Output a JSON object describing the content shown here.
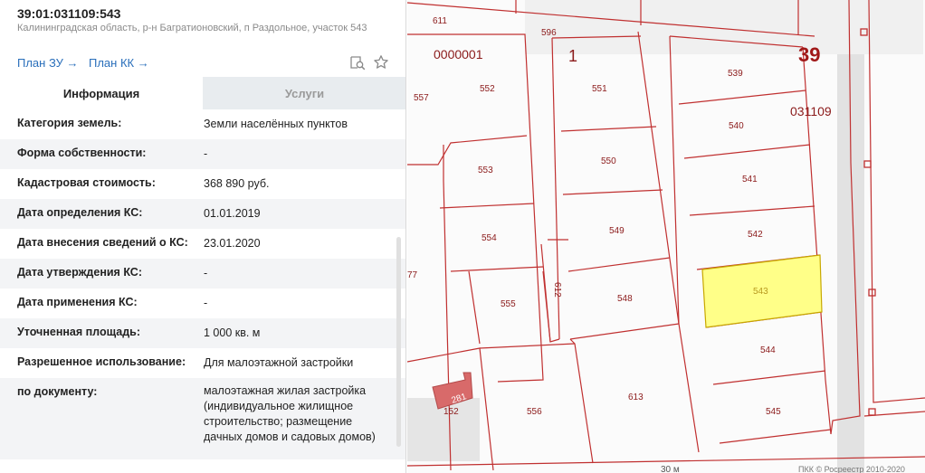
{
  "header": {
    "cadastral_number": "39:01:031109:543",
    "address": "Калининградская область, р-н Багратионовский, п Раздольное, участок 543",
    "links": [
      "План ЗУ →",
      "План КК →"
    ]
  },
  "icons": [
    "search-document-icon",
    "star-icon"
  ],
  "tabs": [
    {
      "label": "Информация",
      "active": true
    },
    {
      "label": "Услуги",
      "active": false
    }
  ],
  "rows": [
    {
      "label": "Категория земель:",
      "value": "Земли населённых пунктов"
    },
    {
      "label": "Форма собственности:",
      "value": "-"
    },
    {
      "label": "Кадастровая стоимость:",
      "value": "368 890 руб."
    },
    {
      "label": "Дата определения КС:",
      "value": "01.01.2019"
    },
    {
      "label": "Дата внесения сведений о КС:",
      "value": "23.01.2020"
    },
    {
      "label": "Дата утверждения КС:",
      "value": "-"
    },
    {
      "label": "Дата применения КС:",
      "value": "-"
    },
    {
      "label": "Уточненная площадь:",
      "value": "1 000 кв. м"
    },
    {
      "label": "Разрешенное использование:",
      "value": "Для малоэтажной застройки"
    },
    {
      "label": "по документу:",
      "value": "малоэтажная жилая застройка (индивидуальное жилищное строительство; размещение дачных домов и садовых домов)"
    }
  ],
  "map": {
    "labels": {
      "block_39": "39",
      "block_031109": "031109",
      "block_0000001": "0000001",
      "block_1": "1",
      "p611": "611",
      "p596": "596",
      "p539": "539",
      "p540": "540",
      "p541": "541",
      "p542": "542",
      "p543": "543",
      "p544": "544",
      "p545": "545",
      "p552": "552",
      "p551": "551",
      "p557": "557",
      "p550": "550",
      "p553": "553",
      "p549": "549",
      "p554": "554",
      "p548": "548",
      "p555": "555",
      "p612": "612",
      "p77": "77",
      "p613": "613",
      "p556": "556",
      "p281": "281",
      "p152": "152",
      "scale": "30 м",
      "copyright": "ПКК © Росреестр 2010-2020"
    },
    "colors": {
      "boundary": "#c03030",
      "selected_fill": "#ffff88",
      "building": "#d86a6a"
    }
  }
}
